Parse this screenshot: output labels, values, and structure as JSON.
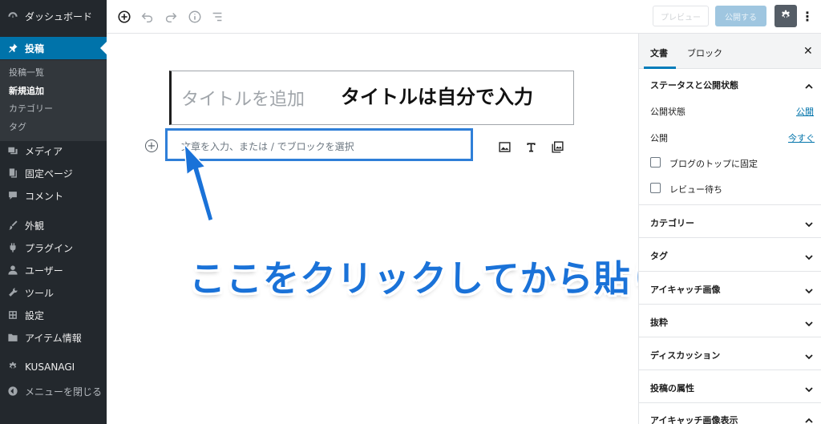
{
  "sidebar": {
    "dashboard": "ダッシュボード",
    "posts": "投稿",
    "submenu": [
      "投稿一覧",
      "新規追加",
      "カテゴリー",
      "タグ"
    ],
    "items": [
      "メディア",
      "固定ページ",
      "コメント",
      "外観",
      "プラグイン",
      "ユーザー",
      "ツール",
      "設定",
      "アイテム情報",
      "KUSANAGI",
      "メニューを閉じる"
    ]
  },
  "toolbar": {
    "preview_label": "プレビュー",
    "publish_label": "公開する",
    "more_label": "⋮"
  },
  "editor": {
    "title_placeholder": "タイトルを追加",
    "title_annotation": "タイトルは自分で入力",
    "paragraph_placeholder": "文章を入力、または / でブロックを選択",
    "add_block_symbol": "+",
    "callout": "ここをクリックしてから貼り付け"
  },
  "panel": {
    "tab_document": "文書",
    "tab_block": "ブロック",
    "close": "✕",
    "status_heading": "ステータスと公開状態",
    "visibility_label": "公開状態",
    "visibility_value": "公開",
    "publish_label": "公開",
    "publish_value": "今すぐ",
    "sticky_label": "ブログのトップに固定",
    "pending_label": "レビュー待ち",
    "sections": [
      "カテゴリー",
      "タグ",
      "アイキャッチ画像",
      "抜粋",
      "ディスカッション",
      "投稿の属性",
      "アイキャッチ画像表示"
    ]
  },
  "colors": {
    "sidebar_bg": "#23282d",
    "accent": "#0073aa",
    "callout_blue": "#1a72d8",
    "highlight_border": "#2f7fd8"
  }
}
